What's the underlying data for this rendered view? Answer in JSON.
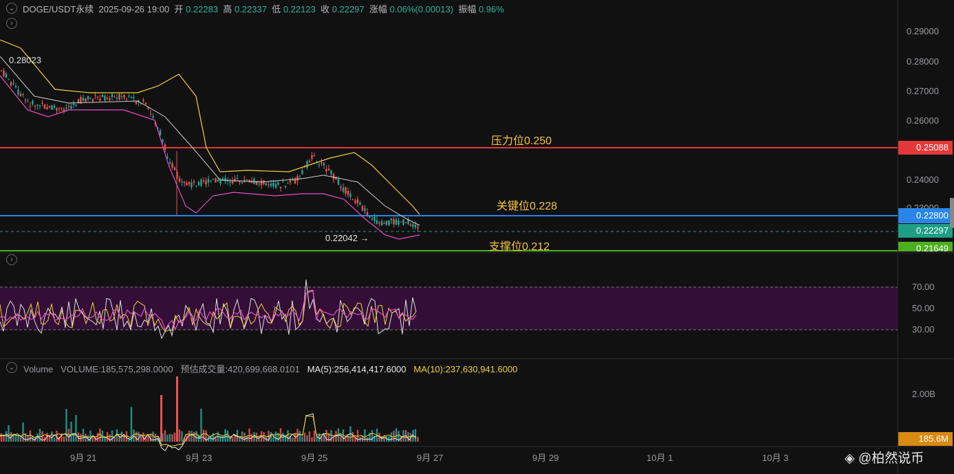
{
  "header": {
    "symbol": "DOGE/USDT永续",
    "datetime": "2025-09-26 19:00",
    "open_label": "开",
    "open": "0.22283",
    "high_label": "高",
    "high": "0.22337",
    "low_label": "低",
    "low": "0.22123",
    "close_label": "收",
    "close": "0.22297",
    "change_label": "涨幅",
    "change": "0.06%(0.00013)",
    "amplitude_label": "振幅",
    "amplitude": "0.96%"
  },
  "price_axis": [
    "0.29000",
    "0.28000",
    "0.27000",
    "0.26000",
    "0.24000"
  ],
  "price_axis_partial": "0.23000",
  "levels": {
    "resistance": {
      "label": "压力位0.250",
      "tag": "0.25088",
      "color": "#e5383b"
    },
    "key": {
      "label": "关键位0.228",
      "tag": "0.22800",
      "color": "#2a85e8"
    },
    "support": {
      "label": "支撑位0.212",
      "tag": "0.21649",
      "color": "#4caf22"
    },
    "last": {
      "tag": "0.22297",
      "color": "#1f9e86"
    }
  },
  "annotations": {
    "high": "0.28023",
    "low": "0.22042 →"
  },
  "rsi_axis": [
    "70.00",
    "50.00",
    "30.00"
  ],
  "volume": {
    "label": "Volume",
    "volume": "VOLUME:185,575,298.0000",
    "estimated": "预估成交量:420,699,668.0101",
    "ma5": "MA(5):256,414,417.6000",
    "ma10": "MA(10):237,630,941.6000",
    "axis": "2.00B",
    "tag": "185.6M"
  },
  "time_axis": [
    "9月 21",
    "9月 23",
    "9月 25",
    "9月 27",
    "9月 29",
    "10月 1",
    "10月 3"
  ],
  "watermark": "@柏然说币",
  "colors": {
    "up": "#26a69a",
    "down": "#ef5350",
    "bb_upper": "#f0d43a",
    "bb_mid": "#cfcfcf",
    "bb_lower": "#e44fc8"
  }
}
